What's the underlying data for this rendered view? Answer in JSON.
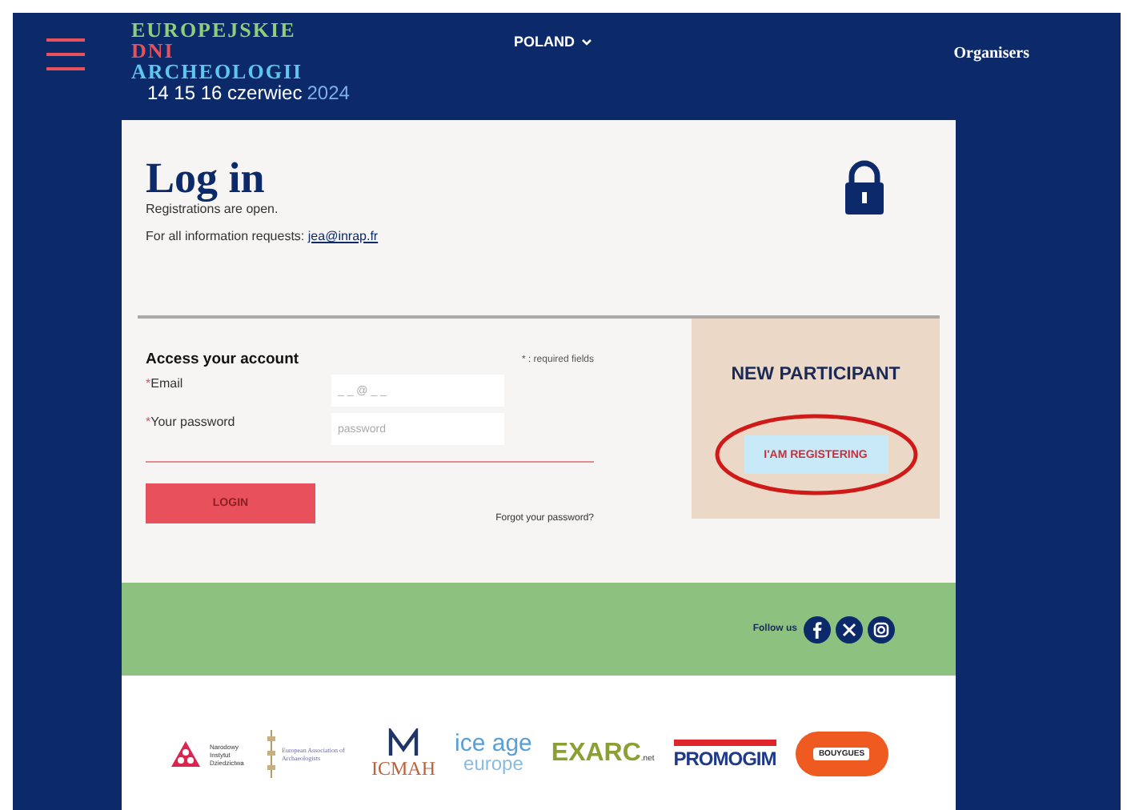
{
  "header": {
    "logo": {
      "lines": [
        {
          "text": "EUROPEJSKIE",
          "color": "#8fcf7a"
        },
        {
          "text": "DNI",
          "color": "#e8505b"
        },
        {
          "text": "ARCHEOLOGII",
          "color": "#5ec8ec"
        }
      ],
      "dates": "14 15 16 czerwiec",
      "year": "2024"
    },
    "country": "POLAND",
    "nav": [
      "Organisers"
    ]
  },
  "login": {
    "title": "Log in",
    "status": "Registrations are open.",
    "info": "For all information requests:",
    "email_link": "jea@inrap.fr"
  },
  "form": {
    "heading": "Access your account",
    "required_note": "* : required fields",
    "fields": [
      {
        "mark": "*",
        "label": "Email",
        "placeholder": "_ _ @ _ _"
      },
      {
        "mark": "*",
        "label": "Your password",
        "placeholder": "password"
      }
    ],
    "submit": "LOGIN",
    "forgot": "Forgot your password?"
  },
  "new_participant": {
    "heading": "NEW PARTICIPANT",
    "button": "I'AM REGISTERING",
    "circled": true
  },
  "social": {
    "label": "Follow us",
    "networks": [
      {
        "kind": "facebook"
      },
      {
        "kind": "x"
      },
      {
        "kind": "instagram"
      }
    ]
  },
  "partners": [
    {
      "kind": "nid",
      "text": "Narodowy Instytut Dziedzictwa"
    },
    {
      "kind": "eaa",
      "text": "European Association of Archaeologists"
    },
    {
      "kind": "icmah",
      "text": "ICMAH"
    },
    {
      "kind": "iceage",
      "text": "ice age",
      "text2": "europe"
    },
    {
      "kind": "exarc",
      "text": "EXARC",
      "text2": ".net"
    },
    {
      "kind": "promogim",
      "text": "PROMOGIM"
    },
    {
      "kind": "bouygues",
      "text": "BOUYGUES"
    }
  ]
}
